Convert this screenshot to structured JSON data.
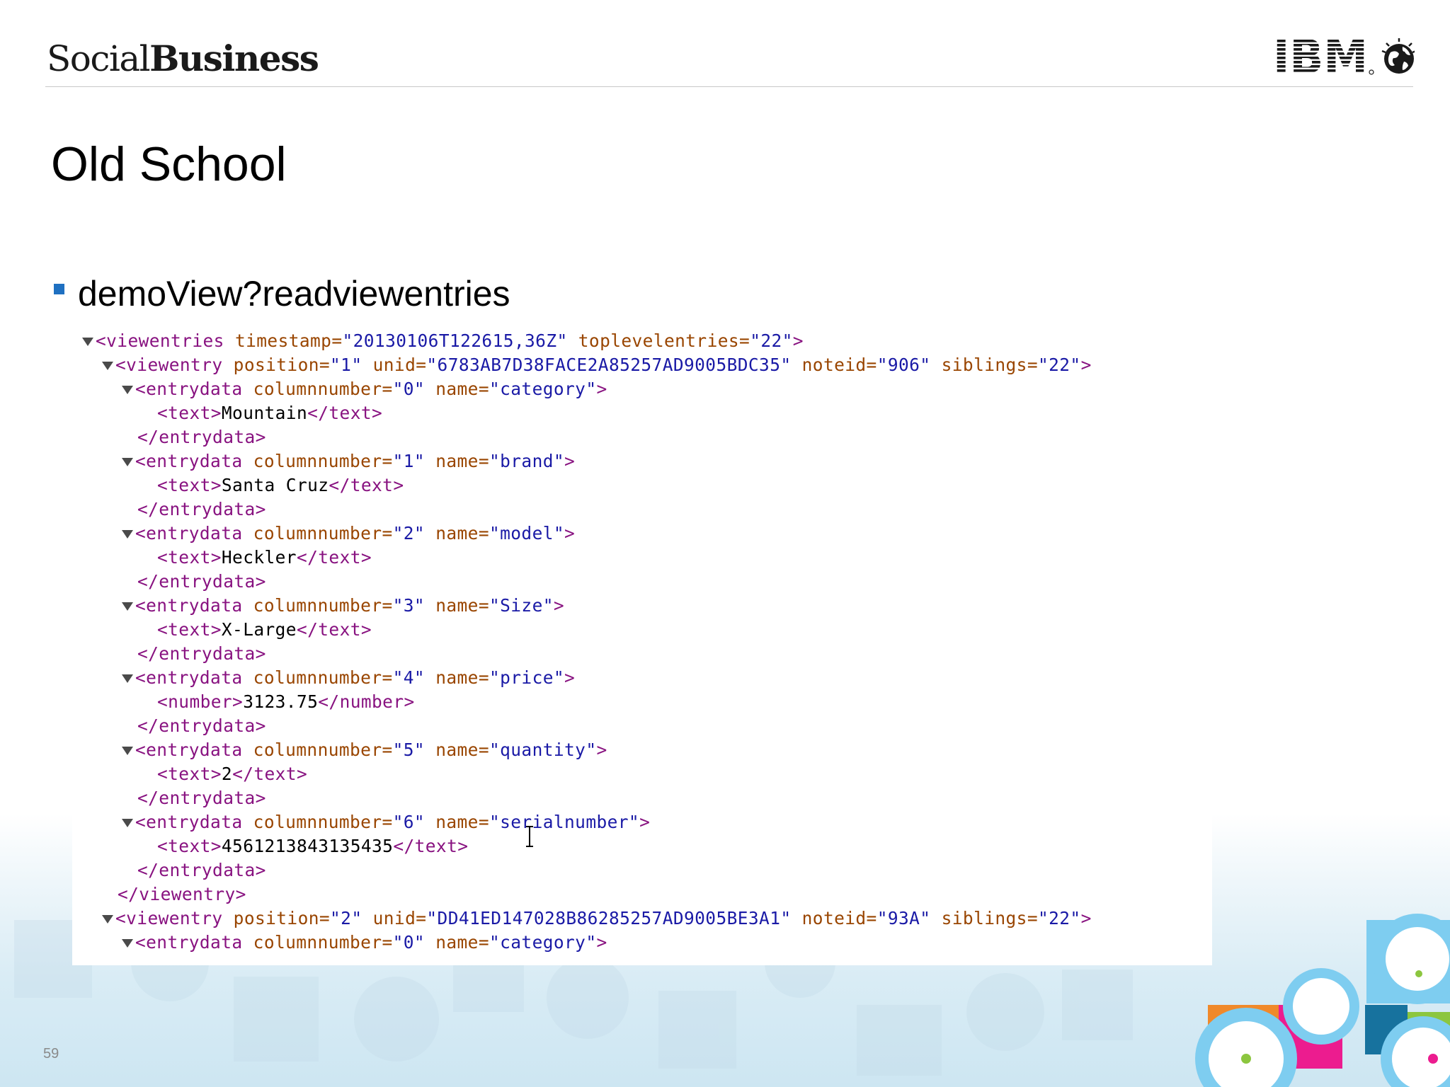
{
  "header": {
    "brand_light": "Social",
    "brand_bold": "Business",
    "logo_text": "IBM",
    "logo_icon": "globe-icon"
  },
  "slide": {
    "title": "Old School",
    "bullet": "demoView?readviewentries",
    "page_number": "59"
  },
  "xml": {
    "l1": {
      "open": "<viewentries",
      "a1": " timestamp=",
      "v1": "\"20130106T122615,36Z\"",
      "a2": " toplevelentries=",
      "v2": "\"22\"",
      "close": ">"
    },
    "l2": {
      "open": "<viewentry",
      "a1": " position=",
      "v1": "\"1\"",
      "a2": " unid=",
      "v2": "\"6783AB7D38FACE2A85257AD9005BDC35\"",
      "a3": " noteid=",
      "v3": "\"906\"",
      "a4": " siblings=",
      "v4": "\"22\"",
      "close": ">"
    },
    "entries1": [
      {
        "open": "<entrydata",
        "a1": " columnnumber=",
        "v1": "\"0\"",
        "a2": " name=",
        "v2": "\"category\"",
        "close": ">",
        "ctag": "<text>",
        "value": "Mountain",
        "cend": "</text>",
        "end": "</entrydata>"
      },
      {
        "open": "<entrydata",
        "a1": " columnnumber=",
        "v1": "\"1\"",
        "a2": " name=",
        "v2": "\"brand\"",
        "close": ">",
        "ctag": "<text>",
        "value": "Santa Cruz",
        "cend": "</text>",
        "end": "</entrydata>"
      },
      {
        "open": "<entrydata",
        "a1": " columnnumber=",
        "v1": "\"2\"",
        "a2": " name=",
        "v2": "\"model\"",
        "close": ">",
        "ctag": "<text>",
        "value": "Heckler",
        "cend": "</text>",
        "end": "</entrydata>"
      },
      {
        "open": "<entrydata",
        "a1": " columnnumber=",
        "v1": "\"3\"",
        "a2": " name=",
        "v2": "\"Size\"",
        "close": ">",
        "ctag": "<text>",
        "value": "X-Large",
        "cend": "</text>",
        "end": "</entrydata>"
      },
      {
        "open": "<entrydata",
        "a1": " columnnumber=",
        "v1": "\"4\"",
        "a2": " name=",
        "v2": "\"price\"",
        "close": ">",
        "ctag": "<number>",
        "value": "3123.75",
        "cend": "</number>",
        "end": "</entrydata>"
      },
      {
        "open": "<entrydata",
        "a1": " columnnumber=",
        "v1": "\"5\"",
        "a2": " name=",
        "v2": "\"quantity\"",
        "close": ">",
        "ctag": "<text>",
        "value": "2",
        "cend": "</text>",
        "end": "</entrydata>"
      },
      {
        "open": "<entrydata",
        "a1": " columnnumber=",
        "v1": "\"6\"",
        "a2": " name=",
        "v2": "\"serialnumber\"",
        "close": ">",
        "ctag": "<text>",
        "value": "4561213843135435",
        "cend": "</text>",
        "end": "</entrydata>"
      }
    ],
    "l_end1": "</viewentry>",
    "l3": {
      "open": "<viewentry",
      "a1": " position=",
      "v1": "\"2\"",
      "a2": " unid=",
      "v2": "\"DD41ED147028B86285257AD9005BE3A1\"",
      "a3": " noteid=",
      "v3": "\"93A\"",
      "a4": " siblings=",
      "v4": "\"22\"",
      "close": ">"
    },
    "l4": {
      "open": "<entrydata",
      "a1": " columnnumber=",
      "v1": "\"0\"",
      "a2": " name=",
      "v2": "\"category\"",
      "close": ">"
    }
  },
  "colors": {
    "accent_blue": "#1f70c1",
    "tag": "#881280",
    "attr": "#994500",
    "value": "#1a1aa6"
  }
}
